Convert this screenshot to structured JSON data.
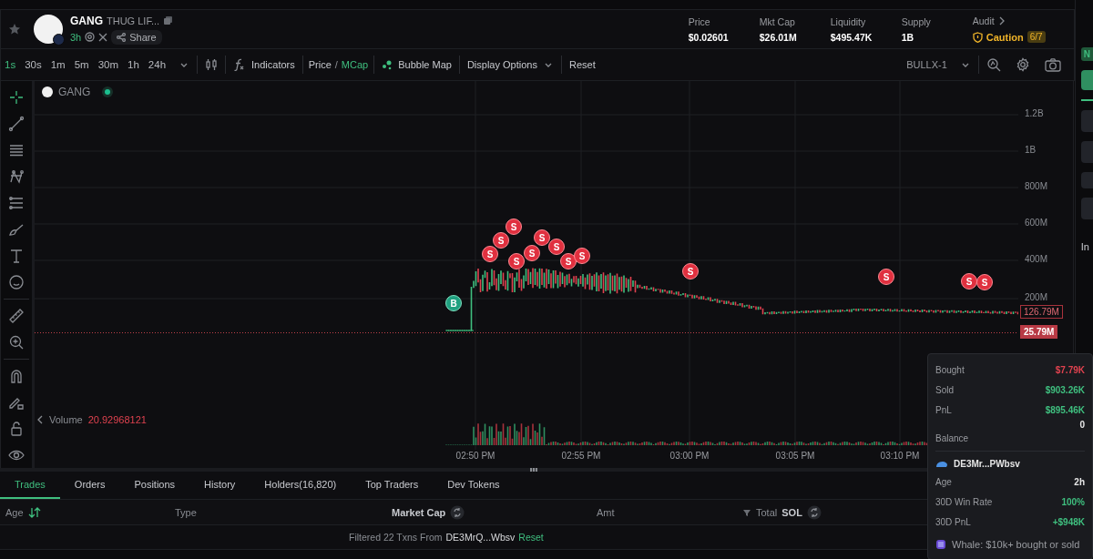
{
  "token": {
    "symbol": "GANG",
    "name": "THUG LIF...",
    "age": "3h",
    "share": "Share"
  },
  "stats": [
    {
      "label": "Price",
      "value": "$0.02601"
    },
    {
      "label": "Mkt Cap",
      "value": "$26.01M"
    },
    {
      "label": "Liquidity",
      "value": "$495.47K"
    },
    {
      "label": "Supply",
      "value": "1B"
    }
  ],
  "audit": {
    "label": "Audit",
    "status": "Caution",
    "score": "6/7"
  },
  "timeframes": [
    {
      "label": "1s",
      "selected": true
    },
    {
      "label": "30s",
      "selected": false
    },
    {
      "label": "1m",
      "selected": false
    },
    {
      "label": "5m",
      "selected": false
    },
    {
      "label": "30m",
      "selected": false
    },
    {
      "label": "1h",
      "selected": false
    },
    {
      "label": "24h",
      "selected": false
    }
  ],
  "toolbar": {
    "indicators": "Indicators",
    "price_toggle": [
      {
        "label": "Price",
        "selected": false
      },
      {
        "label": "MCap",
        "selected": true
      }
    ],
    "separator": "/",
    "bubble_map": "Bubble Map",
    "display_options": "Display Options",
    "reset": "Reset",
    "layout": "BULLX-1"
  },
  "chart": {
    "legend": "GANG",
    "volume_label": "Volume",
    "volume_value": "20.92968121",
    "y_labels": [
      "1.2B",
      "1B",
      "800M",
      "600M",
      "400M",
      "200M"
    ],
    "current_value": "126.79M",
    "price_line": "25.79M",
    "x_labels": [
      "02:50 PM",
      "02:55 PM",
      "03:00 PM",
      "03:05 PM",
      "03:10 PM"
    ],
    "markers": [
      {
        "label": "B",
        "kind": "buy"
      },
      {
        "label": "S",
        "kind": "sell"
      },
      {
        "label": "S",
        "kind": "sell"
      },
      {
        "label": "S",
        "kind": "sell"
      },
      {
        "label": "S",
        "kind": "sell"
      },
      {
        "label": "S",
        "kind": "sell"
      },
      {
        "label": "S",
        "kind": "sell"
      },
      {
        "label": "S",
        "kind": "sell"
      },
      {
        "label": "S",
        "kind": "sell"
      },
      {
        "label": "S",
        "kind": "sell"
      },
      {
        "label": "S",
        "kind": "sell"
      },
      {
        "label": "S",
        "kind": "sell"
      },
      {
        "label": "S",
        "kind": "sell"
      },
      {
        "label": "S",
        "kind": "sell"
      }
    ]
  },
  "tooltip": {
    "rows": [
      {
        "label": "Bought",
        "value": "$7.79K",
        "color": "#e0424f"
      },
      {
        "label": "Sold",
        "value": "$903.26K",
        "color": "#3fbf7f"
      },
      {
        "label": "PnL",
        "value": "$895.46K",
        "color": "#3fbf7f"
      },
      {
        "label": "Balance",
        "value": "0",
        "color": "#e6e6e6"
      }
    ],
    "wallet": "DE3Mr...PWbsv",
    "wallet_rows": [
      {
        "label": "Age",
        "value": "2h",
        "color": "#e6e6e6"
      },
      {
        "label": "30D Win Rate",
        "value": "100%",
        "color": "#3fbf7f"
      },
      {
        "label": "30D PnL",
        "value": "+$948K",
        "color": "#3fbf7f"
      }
    ],
    "footer": "Whale: $10k+ bought or sold"
  },
  "bottom_tabs": [
    {
      "label": "Trades",
      "selected": true
    },
    {
      "label": "Orders",
      "selected": false
    },
    {
      "label": "Positions",
      "selected": false
    },
    {
      "label": "History",
      "selected": false
    },
    {
      "label": "Holders(16,820)",
      "selected": false
    },
    {
      "label": "Top Traders",
      "selected": false
    },
    {
      "label": "Dev Tokens",
      "selected": false
    }
  ],
  "table": {
    "columns": [
      "Age",
      "Type",
      "Market Cap",
      "Amt",
      "Total"
    ],
    "currency": "SOL",
    "filter": {
      "text": "Filtered 22 Txns From",
      "wallet": "DE3MrQ...Wbsv",
      "reset": "Reset"
    }
  },
  "side_panel": {
    "badge": "N",
    "label": "In"
  }
}
